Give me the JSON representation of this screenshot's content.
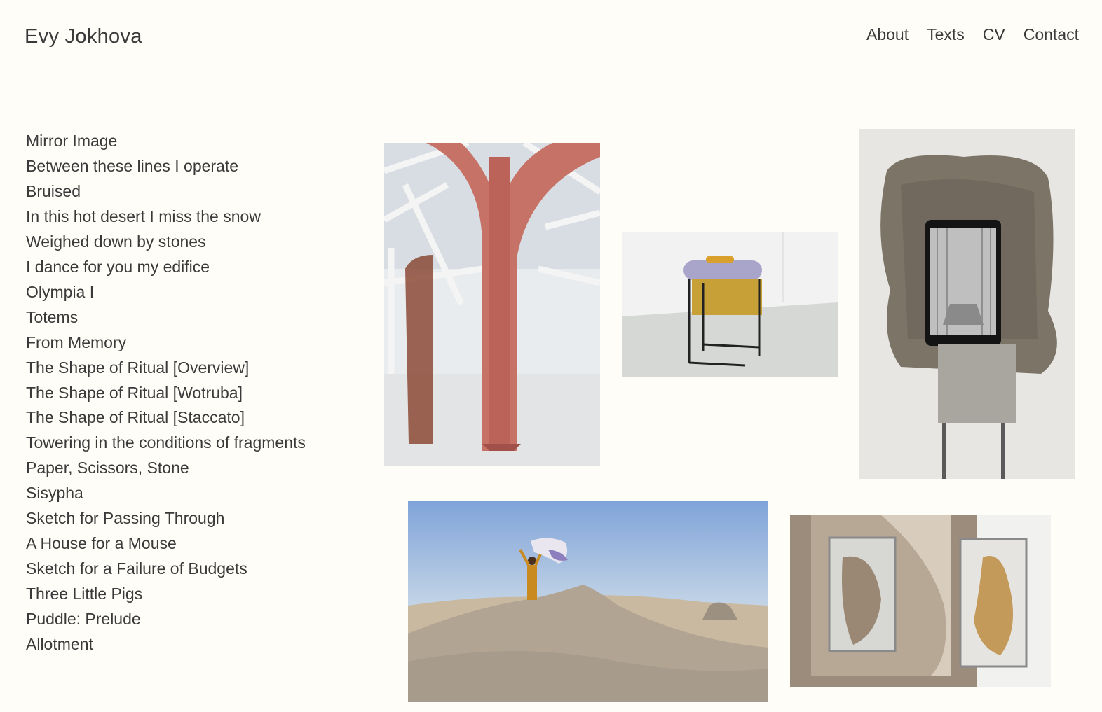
{
  "site": {
    "title": "Evy Jokhova"
  },
  "nav": {
    "items": [
      {
        "label": "About"
      },
      {
        "label": "Texts"
      },
      {
        "label": "CV"
      },
      {
        "label": "Contact"
      }
    ]
  },
  "works": [
    {
      "label": "Mirror Image"
    },
    {
      "label": "Between these lines I operate"
    },
    {
      "label": "Bruised"
    },
    {
      "label": "In this hot desert I miss the snow"
    },
    {
      "label": "Weighed down by stones"
    },
    {
      "label": "I dance for you my edifice"
    },
    {
      "label": "Olympia I"
    },
    {
      "label": "Totems"
    },
    {
      "label": "From Memory"
    },
    {
      "label": "The Shape of Ritual [Overview]"
    },
    {
      "label": "The Shape of Ritual [Wotruba]"
    },
    {
      "label": "The Shape of Ritual [Staccato]"
    },
    {
      "label": "Towering in the conditions of fragments"
    },
    {
      "label": "Paper, Scissors, Stone"
    },
    {
      "label": "Sisypha"
    },
    {
      "label": "Sketch for Passing Through"
    },
    {
      "label": "A House for a Mouse"
    },
    {
      "label": "Sketch for a Failure of Budgets"
    },
    {
      "label": "Three Little Pigs"
    },
    {
      "label": "Puddle: Prelude"
    },
    {
      "label": "Allotment"
    }
  ],
  "colors": {
    "background": "#fffdf7",
    "text": "#3a3a3a"
  }
}
